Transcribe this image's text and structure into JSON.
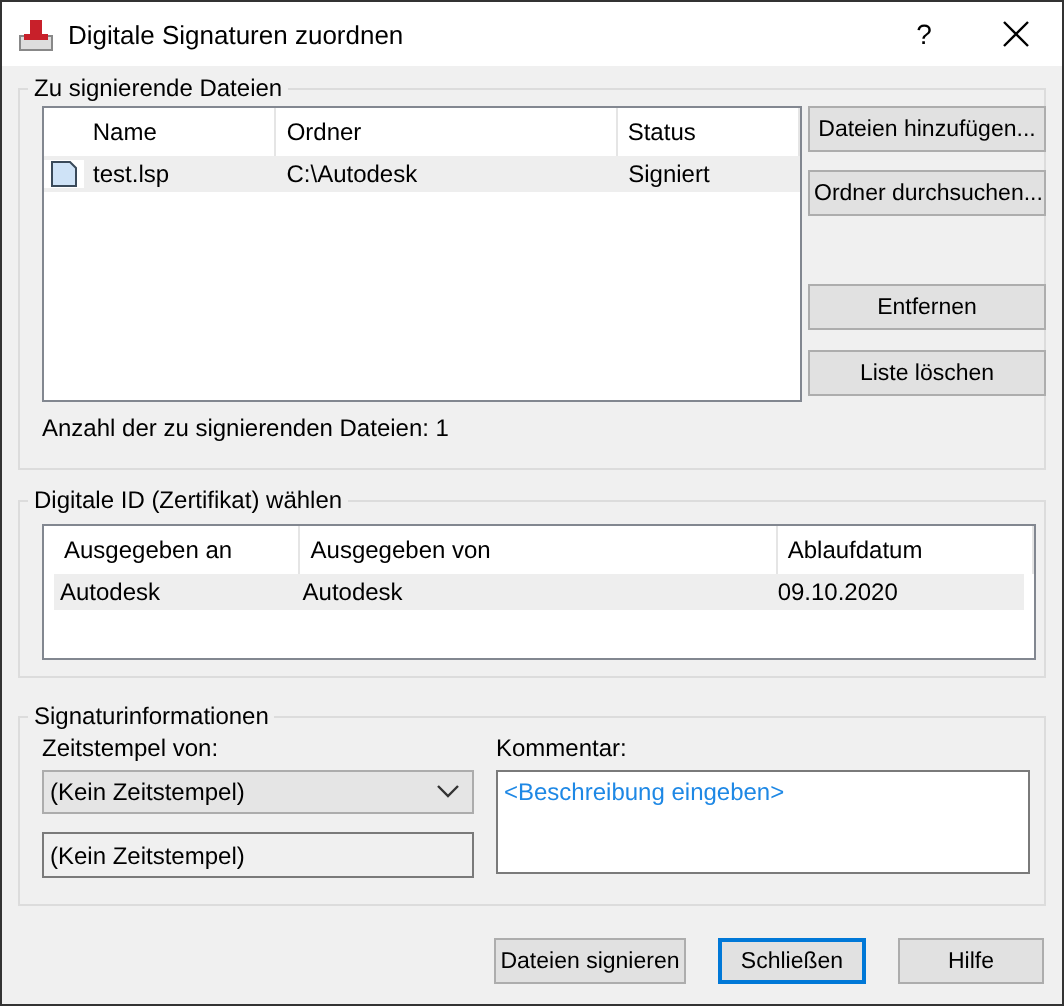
{
  "window": {
    "title": "Digitale Signaturen zuordnen",
    "help": "?"
  },
  "files": {
    "title": "Zu signierende Dateien",
    "columns": [
      "Name",
      "Ordner",
      "Status"
    ],
    "rows": [
      {
        "name": "test.lsp",
        "folder": "C:\\Autodesk",
        "status": "Signiert",
        "selected": true
      }
    ],
    "buttons": [
      "Dateien hinzufügen...",
      "Ordner durchsuchen...",
      "Entfernen",
      "Liste löschen"
    ],
    "count": "Anzahl der zu signierenden Dateien: 1"
  },
  "certificate": {
    "title": "Digitale ID (Zertifikat) wählen",
    "columns": [
      "Ausgegeben an",
      "Ausgegeben von",
      "Ablaufdatum"
    ],
    "rows": [
      {
        "cells": [
          "Autodesk",
          "Autodesk",
          "09.10.2020"
        ],
        "selected": true
      }
    ]
  },
  "signature": {
    "title": "Signaturinformationen",
    "timestamp_label": "Zeitstempel von:",
    "timestamp_value": "(Kein Zeitstempel)",
    "timestamp_display": "(Kein Zeitstempel)",
    "comment_label": "Kommentar:",
    "comment_placeholder": "<Beschreibung eingeben>"
  },
  "buttons": [
    {
      "label": "Dateien signieren",
      "focused": false
    },
    {
      "label": "Schließen",
      "focused": true
    },
    {
      "label": "Hilfe",
      "focused": false
    }
  ]
}
